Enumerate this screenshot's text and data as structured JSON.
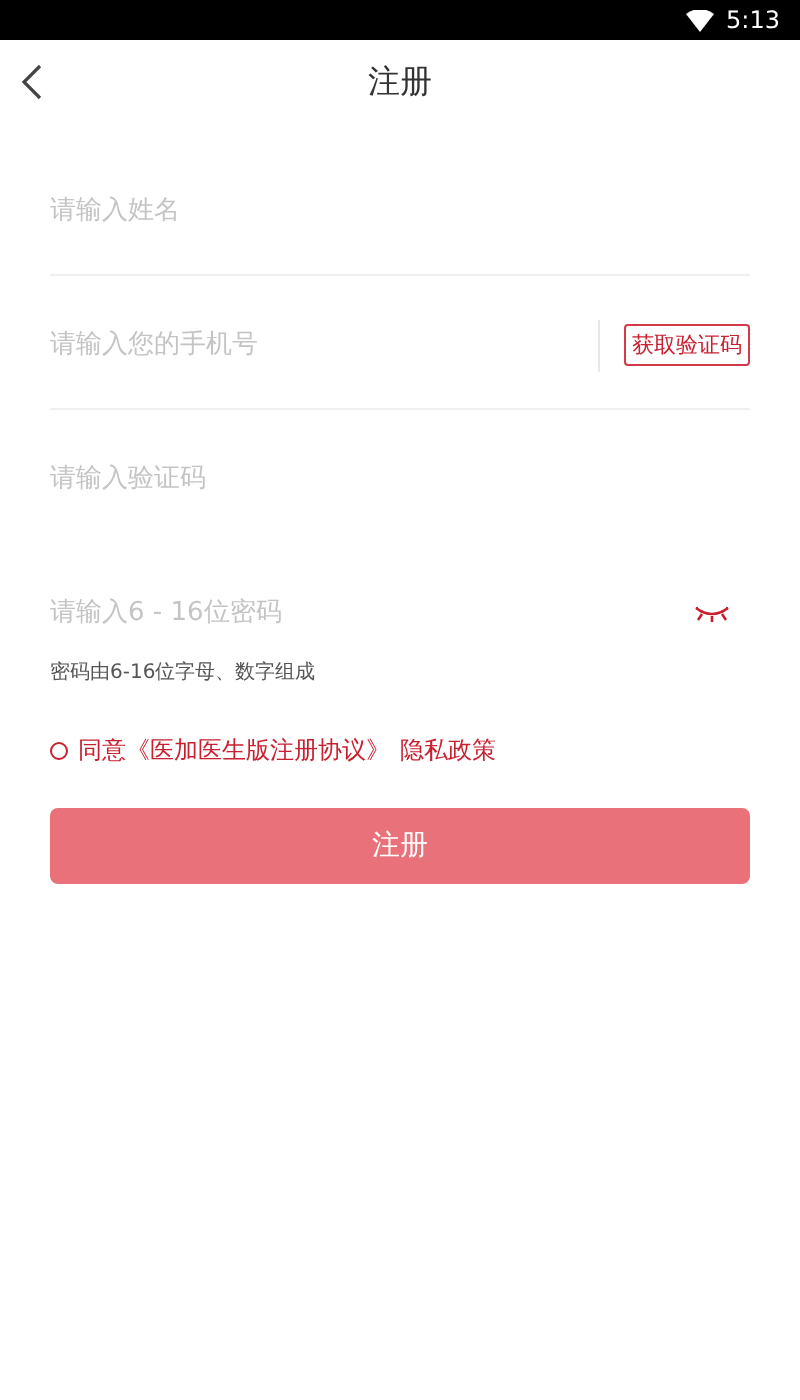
{
  "status_bar": {
    "time": "5:13"
  },
  "header": {
    "title": "注册"
  },
  "fields": [
    {
      "kind": "text",
      "placeholder": "请输入姓名",
      "divider": true
    },
    {
      "kind": "phone",
      "placeholder": "请输入您的手机号",
      "button": "获取验证码",
      "divider": true
    },
    {
      "kind": "text",
      "placeholder": "请输入验证码",
      "divider": false
    },
    {
      "kind": "password",
      "placeholder": "请输入6 - 16位密码",
      "divider": false,
      "hint": "密码由6-16位字母、数字组成"
    }
  ],
  "agreement": {
    "checked": false,
    "prefix": "同意",
    "terms_link": "《医加医生版注册协议》",
    "privacy_link": "隐私政策"
  },
  "submit_button": "注册"
}
